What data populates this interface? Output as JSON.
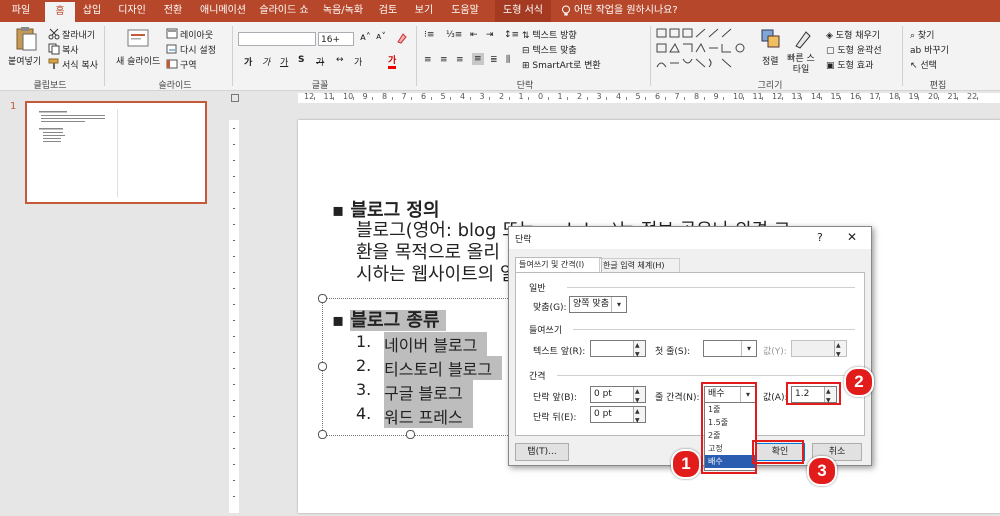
{
  "tabs": [
    "파일",
    "홈",
    "삽입",
    "디자인",
    "전환",
    "애니메이션",
    "슬라이드 쇼",
    "녹음/녹화",
    "검토",
    "보기",
    "도움말",
    "도형 서식"
  ],
  "tell_me": "어떤 작업을 원하시나요?",
  "ribbon": {
    "clipboard": {
      "paste": "붙여넣기",
      "cut": "잘라내기",
      "copy": "복사",
      "format_painter": "서식 복사",
      "label": "클립보드"
    },
    "slides": {
      "new_slide": "새 슬라이드",
      "layout": "레이아웃",
      "reset": "다시 설정",
      "section": "구역",
      "label": "슬라이드"
    },
    "font": {
      "size": "16+",
      "label": "글꼴"
    },
    "paragraph": {
      "text_direction": "텍스트 방향",
      "align_text": "텍스트 맞춤",
      "smartart": "SmartArt로 변환",
      "label": "단락"
    },
    "drawing": {
      "arrange": "정렬",
      "quick_styles": "빠른 스타일",
      "fill": "도형 채우기",
      "outline": "도형 윤곽선",
      "effects": "도형 효과",
      "label": "그리기"
    },
    "editing": {
      "find": "찾기",
      "replace": "바꾸기",
      "select": "선택",
      "label": "편집"
    }
  },
  "slide_number": "1",
  "ruler_numbers": [
    "12",
    "11",
    "10",
    "9",
    "8",
    "7",
    "6",
    "5",
    "4",
    "3",
    "2",
    "1",
    "0",
    "1",
    "2",
    "3",
    "4",
    "5",
    "6",
    "7",
    "8",
    "9",
    "10",
    "11",
    "12",
    "13",
    "14",
    "15",
    "16",
    "17",
    "18",
    "19",
    "20",
    "21",
    "22"
  ],
  "slide": {
    "heading1": "블로그 정의",
    "para": [
      "블로그(영어: blog 또는 web log)는 정보 공유나 의견 교",
      "환을 목적으로 올리",
      "시하는 웹사이트의 일"
    ],
    "heading2": "블로그 종류",
    "items": [
      {
        "num": "1.",
        "text": "네이버 블로그"
      },
      {
        "num": "2.",
        "text": "티스토리 블로그"
      },
      {
        "num": "3.",
        "text": "구글 블로그"
      },
      {
        "num": "4.",
        "text": "워드 프레스"
      }
    ]
  },
  "dialog": {
    "title": "단락",
    "help": "?",
    "close": "✕",
    "tab1": "들여쓰기 및 간격(I)",
    "tab2": "한글 입력 체계(H)",
    "general": "일반",
    "align_label": "맞춤(G):",
    "align_value": "양쪽 맞춤",
    "indent": "들여쓰기",
    "before_text_label": "텍스트 앞(R):",
    "first_line_label": "첫 줄(S):",
    "by_label": "값(Y):",
    "spacing": "간격",
    "before_label": "단락 앞(B):",
    "before_value": "0 pt",
    "after_label": "단락 뒤(E):",
    "after_value": "0 pt",
    "line_spacing_label": "줄 간격(N):",
    "line_spacing_value": "배수",
    "at_label": "값(A):",
    "at_value": "1.2",
    "options": [
      "1줄",
      "1.5줄",
      "2줄",
      "고정",
      "배수"
    ],
    "tabs_button": "탭(T)...",
    "ok": "확인",
    "cancel": "취소"
  },
  "badges": [
    "1",
    "2",
    "3"
  ],
  "colors": {
    "accent": "#b7472a",
    "highlight": "#e21b1b",
    "selected": "#2a5db0"
  }
}
